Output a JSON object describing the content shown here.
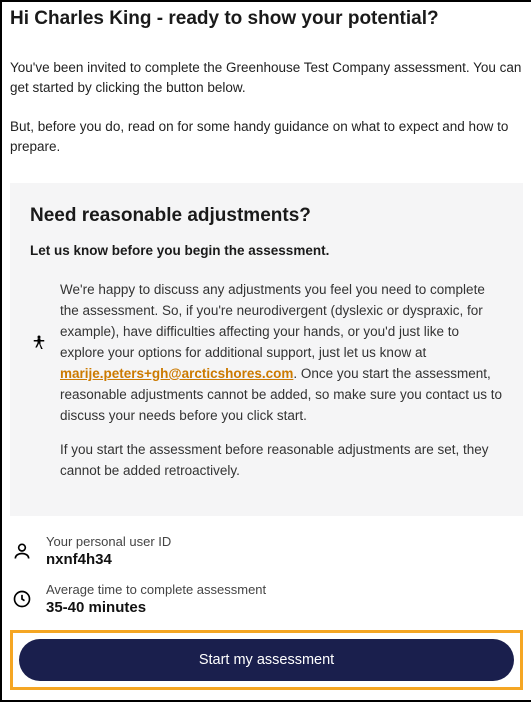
{
  "title": "Hi Charles King - ready to show your potential?",
  "intro": {
    "p1": "You've been invited to complete the Greenhouse Test Company assessment. You can get started by clicking the button below.",
    "p2": "But, before you do, read on for some handy guidance on what to expect and how to prepare."
  },
  "adjustments": {
    "heading": "Need reasonable adjustments?",
    "subheading": "Let us know before you begin the assessment.",
    "p1_before": "We're happy to discuss any adjustments you feel you need to complete the assessment. So, if you're neurodivergent (dyslexic or dyspraxic, for example), have difficulties affecting your hands, or you'd just like to explore your options for additional support, just let us know at ",
    "email": "marije.peters+gh@arcticshores.com",
    "p1_after": ". Once you start the assessment, reasonable adjustments cannot be added, so make sure you contact us to discuss your needs before you click start.",
    "p2": "If you start the assessment before reasonable adjustments are set, they cannot be added retroactively."
  },
  "user_id": {
    "label": "Your personal user ID",
    "value": "nxnf4h34"
  },
  "avg_time": {
    "label": "Average time to complete assessment",
    "value": "35-40 minutes"
  },
  "button": {
    "label": "Start my assessment"
  }
}
